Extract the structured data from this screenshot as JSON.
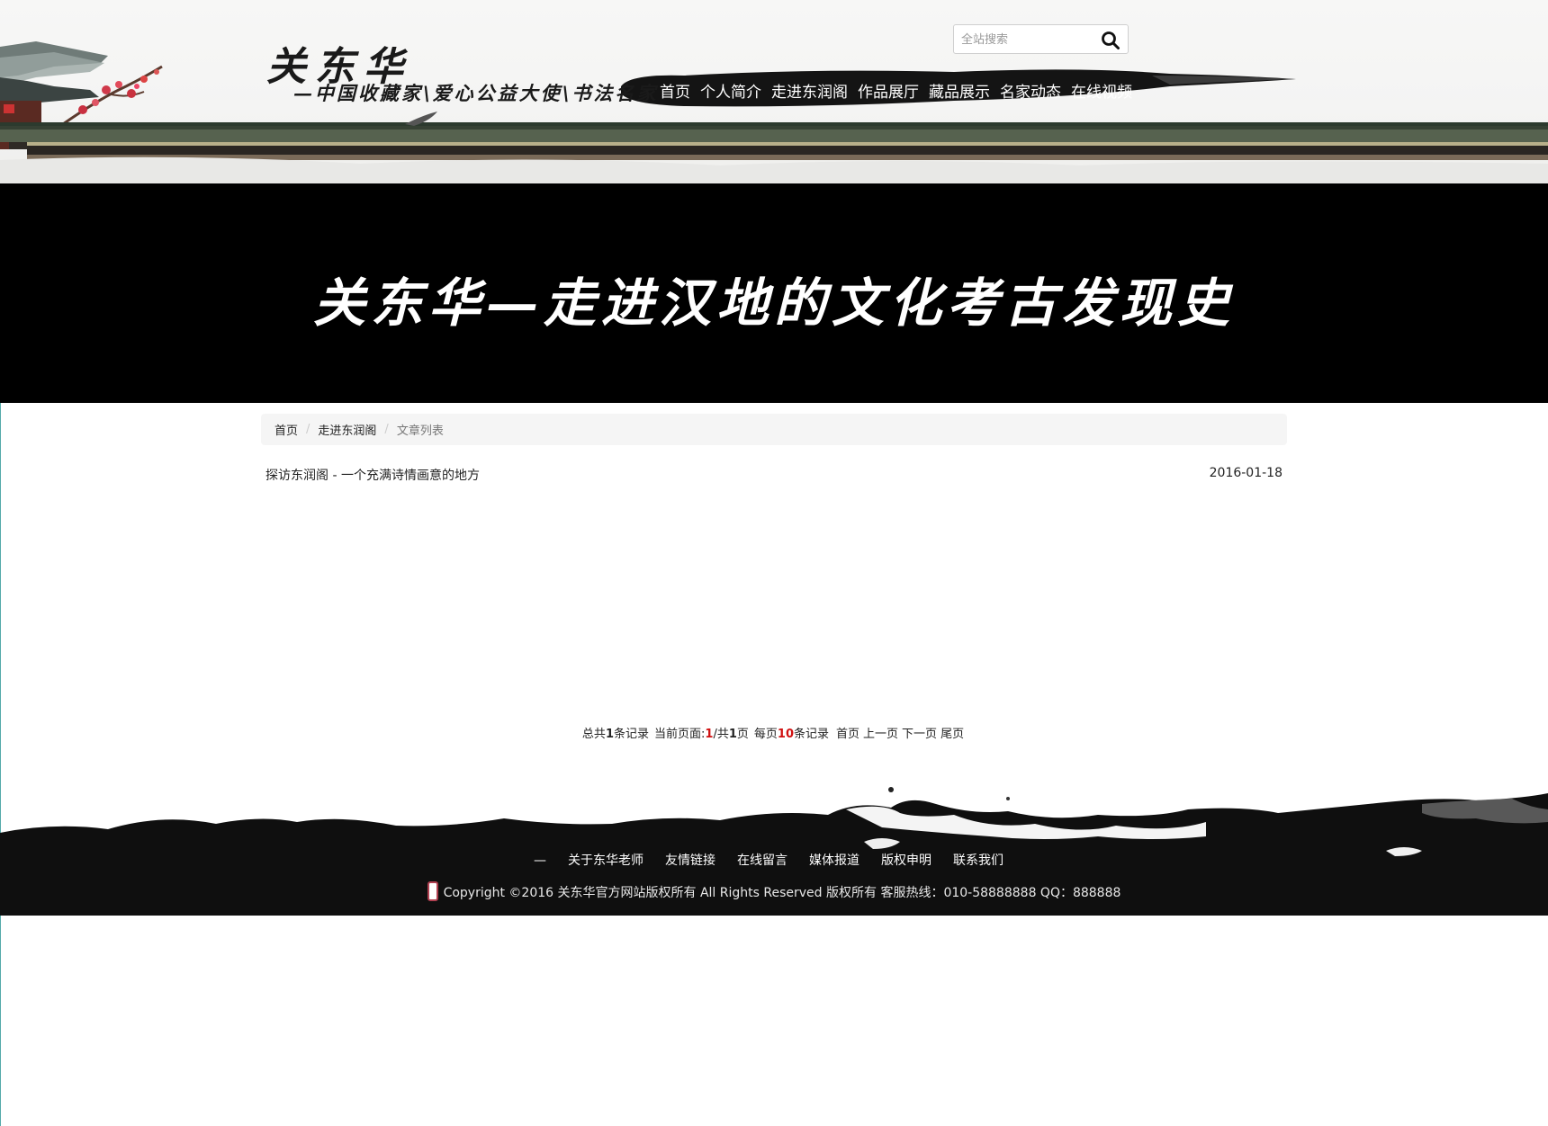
{
  "header": {
    "logo_name": "关东华",
    "logo_tagline": "—中国收藏家\\爱心公益大使\\书法名家",
    "search": {
      "placeholder": "全站搜索",
      "icon": "search-icon"
    },
    "nav": [
      {
        "label": "首页"
      },
      {
        "label": "个人简介"
      },
      {
        "label": "走进东润阁"
      },
      {
        "label": "作品展厅"
      },
      {
        "label": "藏品展示"
      },
      {
        "label": "名家动态"
      },
      {
        "label": "在线视频"
      }
    ]
  },
  "banner": {
    "title": "关东华—走进汉地的文化考古发现史"
  },
  "breadcrumb": {
    "items": [
      {
        "label": "首页"
      },
      {
        "label": "走进东润阁"
      }
    ],
    "current": "文章列表"
  },
  "articles": [
    {
      "title": "探访东润阁 - 一个充满诗情画意的地方",
      "date": "2016-01-18"
    }
  ],
  "pagination": {
    "total_prefix": "总共",
    "total_records": "1",
    "total_suffix": "条记录",
    "current_prefix": "当前页面:",
    "current_page": "1",
    "pages_sep": "/共",
    "total_pages": "1",
    "pages_suffix": "页",
    "per_page_prefix": "每页",
    "per_page": "10",
    "per_page_suffix": "条记录",
    "first": "首页",
    "prev": "上一页",
    "next": "下一页",
    "last": "尾页"
  },
  "footer": {
    "dash": "—",
    "links": [
      {
        "label": "关于东华老师"
      },
      {
        "label": "友情链接"
      },
      {
        "label": "在线留言"
      },
      {
        "label": "媒体报道"
      },
      {
        "label": "版权申明"
      },
      {
        "label": "联系我们"
      }
    ],
    "copyright": "Copyright ©2016 关东华官方网站版权所有 All Rights Reserved 版权所有 客服热线：010-58888888 QQ：888888",
    "phone_icon": "phone-icon"
  },
  "colors": {
    "banner_bg": "#000000",
    "accent_red": "#d01010",
    "breadcrumb_bg": "#f5f5f5"
  }
}
